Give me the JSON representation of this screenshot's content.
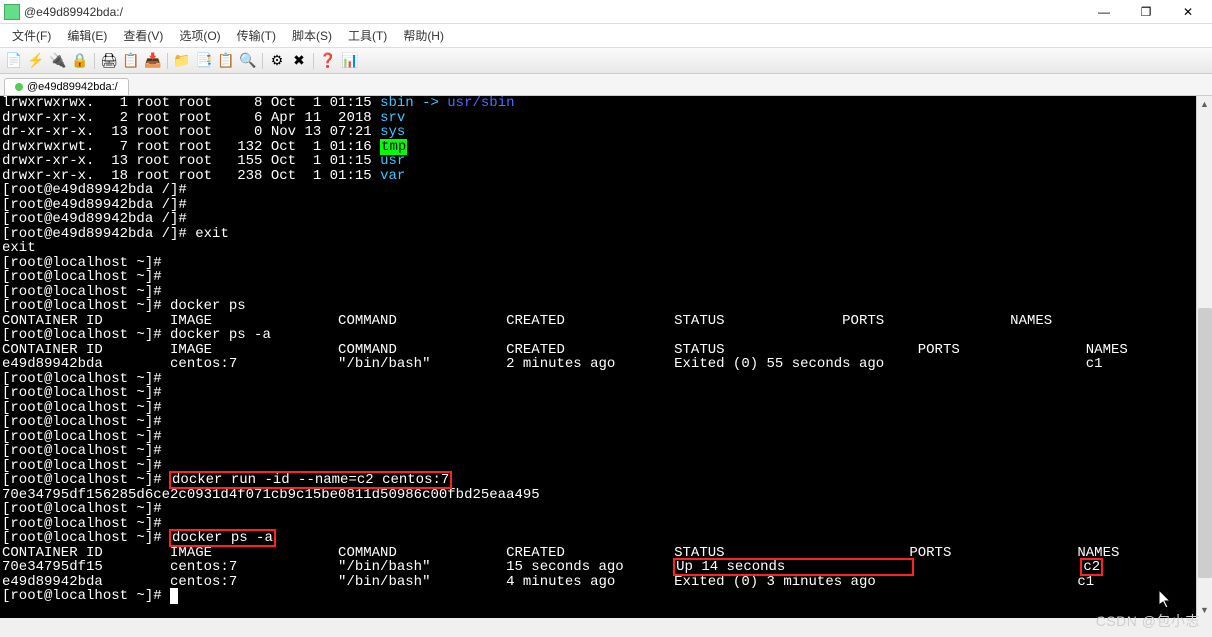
{
  "window": {
    "title": "@e49d89942bda:/",
    "min_icon": "—",
    "max_icon": "❐",
    "close_icon": "✕"
  },
  "menu": {
    "file": "文件(F)",
    "edit": "编辑(E)",
    "view": "查看(V)",
    "options": "选项(O)",
    "transfer": "传输(T)",
    "script": "脚本(S)",
    "tools": "工具(T)",
    "help": "帮助(H)"
  },
  "tab": {
    "label": "@e49d89942bda:/"
  },
  "term": {
    "l1a": "lrwxrwxrwx.   1 root root     8 Oct  1 01:15 ",
    "l1b": "sbin -> ",
    "l1c": "usr/sbin",
    "l2a": "drwxr-xr-x.   2 root root     6 Apr 11  2018 ",
    "l2b": "srv",
    "l3a": "dr-xr-xr-x.  13 root root     0 Nov 13 07:21 ",
    "l3b": "sys",
    "l4a": "drwxrwxrwt.   7 root root   132 Oct  1 01:16 ",
    "l4b": "tmp",
    "l5a": "drwxr-xr-x.  13 root root   155 Oct  1 01:15 ",
    "l5b": "usr",
    "l6a": "drwxr-xr-x.  18 root root   238 Oct  1 01:15 ",
    "l6b": "var",
    "p_container": "[root@e49d89942bda /]# ",
    "exit_cmd": "exit",
    "exit_out": "exit",
    "p_local": "[root@localhost ~]# ",
    "dps": "docker ps",
    "header_short": "CONTAINER ID        IMAGE               COMMAND             CREATED             STATUS              PORTS               NAMES",
    "dpsa": "docker ps -a",
    "header_wide": "CONTAINER ID        IMAGE               COMMAND             CREATED             STATUS                       PORTS               NAMES",
    "row_c1": "e49d89942bda        centos:7            \"/bin/bash\"         2 minutes ago       Exited (0) 55 seconds ago                        c1",
    "run_cmd": "docker run -id --name=c2 centos:7",
    "run_out": "70e34795df156285d6ce2c0931d4f071cb9c15be0811d50986c00fbd25eaa495",
    "header_wide2": "CONTAINER ID        IMAGE               COMMAND             CREATED             STATUS                      PORTS               NAMES",
    "row2_id": "70e34795df15        centos:7            \"/bin/bash\"         15 seconds ago      ",
    "row2_status": "Up 14 seconds               ",
    "row2_rest": "                    ",
    "row2_name": "c2",
    "row3": "e49d89942bda        centos:7            \"/bin/bash\"         4 minutes ago       Exited (0) 3 minutes ago                        c1",
    "cursor": " "
  },
  "watermark": "CSDN @包小志"
}
